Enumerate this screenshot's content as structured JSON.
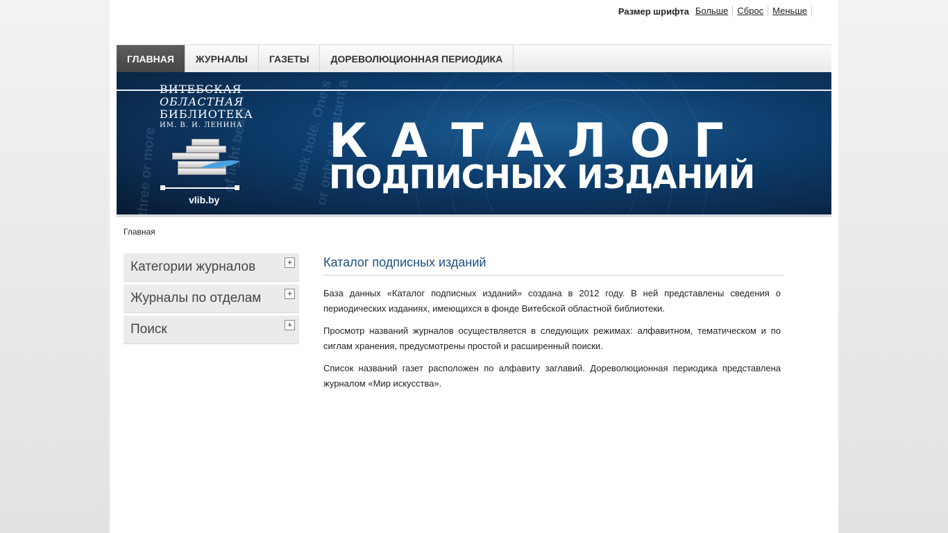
{
  "font_size_bar": {
    "label": "Размер шрифта",
    "bigger": "Больше",
    "reset": "Сброс",
    "smaller": "Меньше"
  },
  "nav": {
    "items": [
      {
        "label": "ГЛАВНАЯ",
        "active": true
      },
      {
        "label": "ЖУРНАЛЫ",
        "active": false
      },
      {
        "label": "ГАЗЕТЫ",
        "active": false
      },
      {
        "label": "ДОРЕВОЛЮЦИОННАЯ ПЕРИОДИКА",
        "active": false
      }
    ]
  },
  "banner": {
    "logo": {
      "line1": "ВИТЕБСКАЯ",
      "line2": "ОБЛАСТНАЯ",
      "line3": "БИБЛИОТЕКА",
      "line4": "ИМ. В. И. ЛЕНИНА",
      "site": "vlib.by"
    },
    "title_line1": "КАТАЛОГ",
    "title_line2": "ПОДПИСНЫХ ИЗДАНИЙ",
    "background_text": [
      "black hole. One s",
      "or only an instant a",
      "e three or more",
      "of light beam"
    ]
  },
  "breadcrumb": "Главная",
  "sidebar": {
    "items": [
      {
        "label": "Категории журналов",
        "toggle": "+"
      },
      {
        "label": "Журналы по отделам",
        "toggle": "+"
      },
      {
        "label": "Поиск",
        "toggle": "+"
      }
    ]
  },
  "main": {
    "title": "Каталог подписных изданий",
    "paragraphs": [
      "База данных «Каталог подписных изданий» создана в 2012 году. В ней представлены сведения о периодических изданиях, имеющихся в фонде Витебской областной библиотеки.",
      "Просмотр названий журналов осуществляется в следующих режимах: алфавитном, тематическом и по сиглам хранения, предусмотрены простой и расширенный поиски.",
      "Список названий газет расположен по алфавиту заглавий. Дореволюционная периодика представлена журналом «Мир искусства»."
    ]
  },
  "colors": {
    "banner_blue": "#0d3e6e",
    "title_blue": "#1b4f80",
    "nav_active": "#4d4d4d"
  }
}
